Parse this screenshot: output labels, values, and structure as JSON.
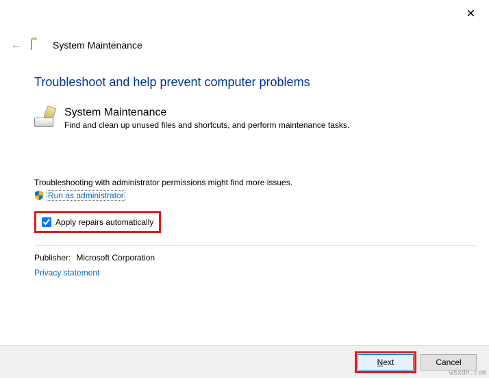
{
  "window": {
    "title": "System Maintenance"
  },
  "heading": "Troubleshoot and help prevent computer problems",
  "troubleshooter": {
    "name": "System Maintenance",
    "description": "Find and clean up unused files and shortcuts, and perform maintenance tasks."
  },
  "admin": {
    "note": "Troubleshooting with administrator permissions might find more issues.",
    "link": "Run as administrator"
  },
  "checkbox": {
    "label": "Apply repairs automatically",
    "checked": true
  },
  "publisher": {
    "label": "Publisher:",
    "value": "Microsoft Corporation"
  },
  "privacy_link": "Privacy statement",
  "buttons": {
    "next_prefix": "N",
    "next_rest": "ext",
    "cancel": "Cancel"
  },
  "watermark": "wsxdn.com"
}
